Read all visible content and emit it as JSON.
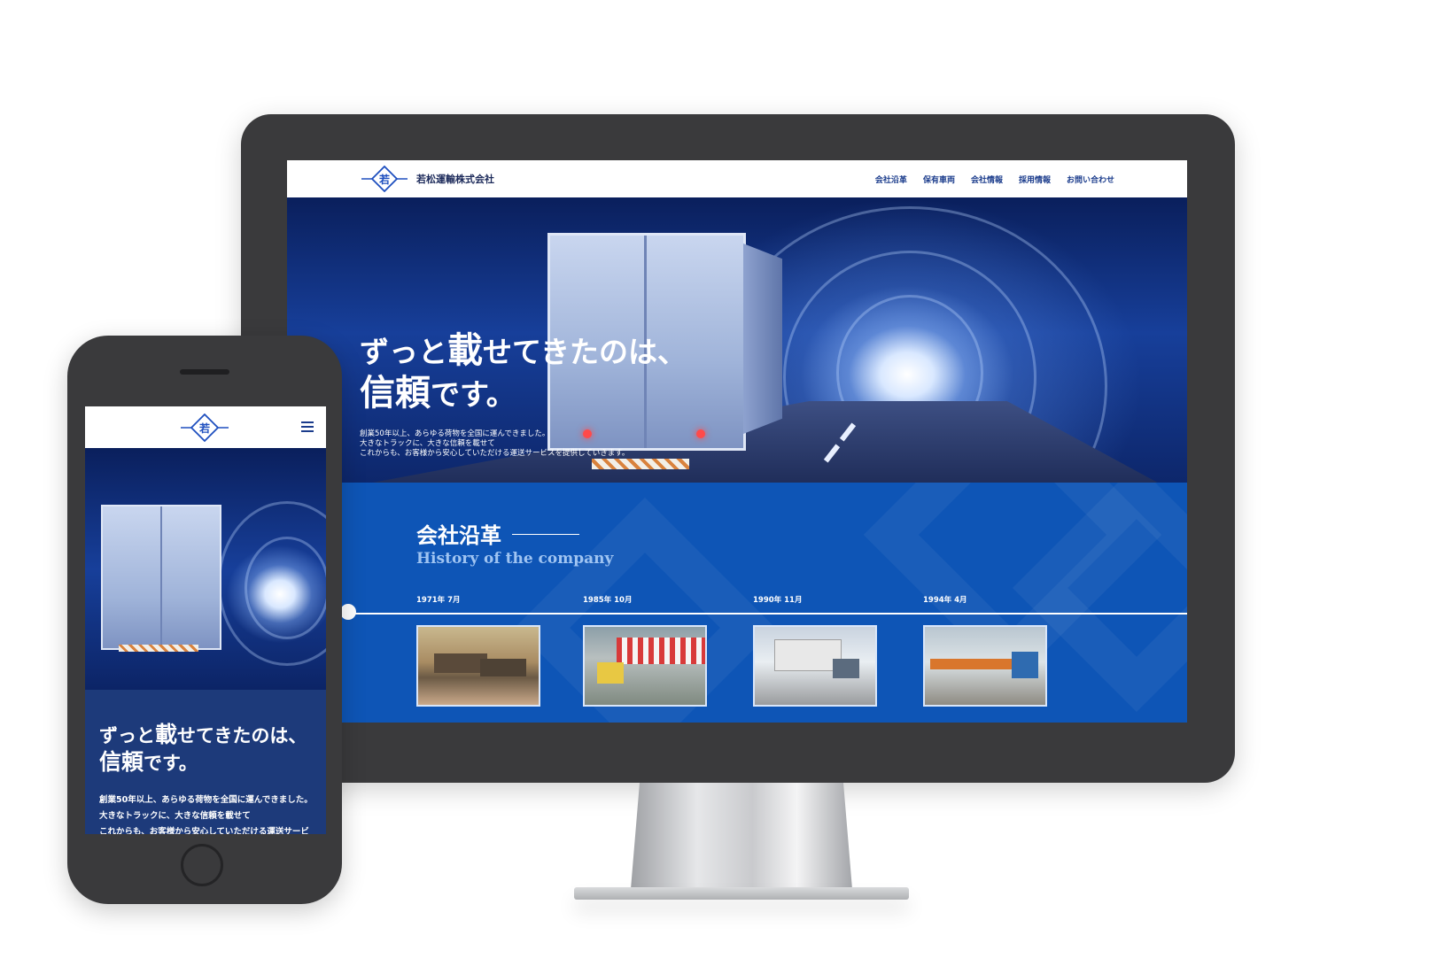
{
  "desktop": {
    "company_name": "若松運輸株式会社",
    "logo_char": "若",
    "nav": [
      "会社沿革",
      "保有車両",
      "会社情報",
      "採用情報",
      "お問い合わせ"
    ],
    "hero": {
      "title_line1_a": "ずっと",
      "title_line1_b": "載",
      "title_line1_c": "せてきたのは、",
      "title_line2_a": "信頼",
      "title_line2_b": "です。",
      "body": [
        "創業50年以上、あらゆる荷物を全国に運んできました。",
        "大きなトラックに、大きな信頼を載せて",
        "これからも、お客様から安心していただける運送サービスを提供していきます。"
      ]
    },
    "history": {
      "title": "会社沿革",
      "subtitle": "History of the company",
      "items": [
        {
          "date": "1971年 7月"
        },
        {
          "date": "1985年 10月"
        },
        {
          "date": "1990年 11月"
        },
        {
          "date": "1994年 4月"
        }
      ]
    }
  },
  "mobile": {
    "logo_char": "若",
    "hero": {
      "title_line1_a": "ずっと",
      "title_line1_b": "載",
      "title_line1_c": "せてきたのは、",
      "title_line2_a": "信頼",
      "title_line2_b": "です。",
      "body": [
        "創業50年以上、あらゆる荷物を全国に運んできました。",
        "大きなトラックに、大きな信頼を載せて",
        "これからも、お客様から安心していただける運送サービ"
      ]
    }
  },
  "colors": {
    "brand_blue": "#0e55b6",
    "navy": "#1d3a7a",
    "device_frame": "#3a3a3c"
  },
  "icons": [
    "logo-mark-icon",
    "hamburger-menu-icon",
    "timeline-dot-icon"
  ]
}
